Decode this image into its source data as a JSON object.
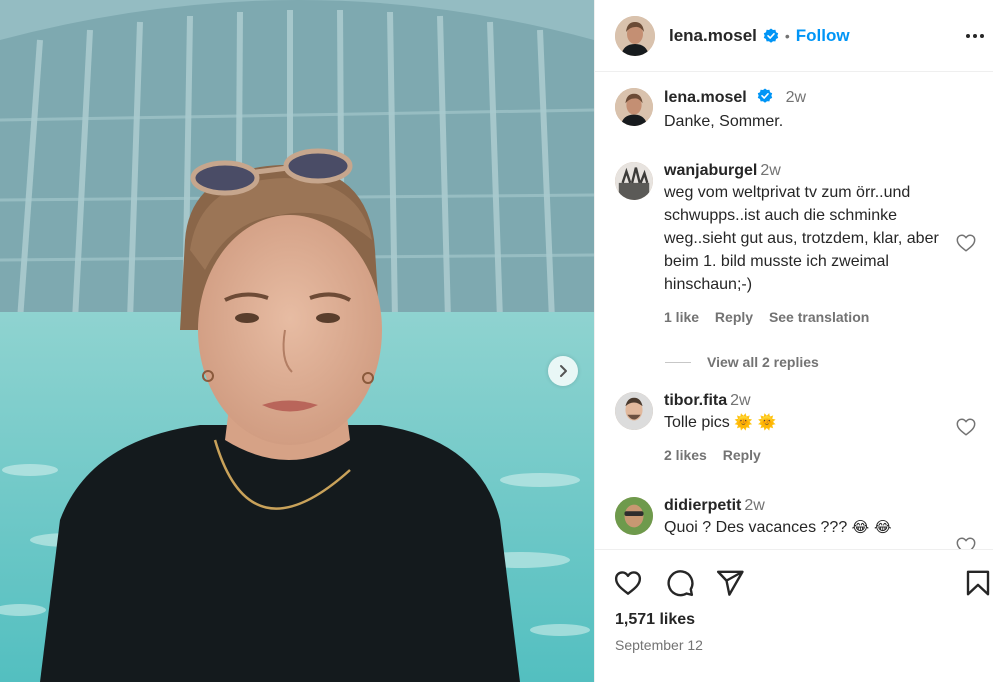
{
  "post": {
    "author": "lena.mosel",
    "follow_label": "Follow",
    "separator": "•",
    "caption_time": "2w",
    "caption": "Danke, Sommer.",
    "likes": "1,571 likes",
    "date": "September 12"
  },
  "comments": [
    {
      "user": "wanjaburgel",
      "time": "2w",
      "text": "weg vom weltprivat tv zum örr..und schwupps..ist auch die schminke weg..sieht gut aus, trotzdem, klar, aber beim 1. bild musste ich zweimal hinschaun;-)",
      "likes": "1 like",
      "reply": "Reply",
      "translate": "See translation",
      "view_replies": "View all 2 replies"
    },
    {
      "user": "tibor.fita",
      "time": "2w",
      "text": "Tolle pics",
      "emoji": "🌞 🌞",
      "likes": "2 likes",
      "reply": "Reply"
    },
    {
      "user": "didierpetit",
      "time": "2w",
      "text": "Quoi ? Des vacances ???",
      "emoji": "😂 😂"
    }
  ],
  "icons": {
    "header": [
      "verified-icon",
      "more-options-icon"
    ],
    "actions": [
      "heart-icon",
      "comment-icon",
      "share-icon",
      "bookmark-icon"
    ],
    "carousel": "chevron-right-icon"
  },
  "colors": {
    "accent": "#0095f6",
    "text": "#262626",
    "muted": "#737373"
  }
}
